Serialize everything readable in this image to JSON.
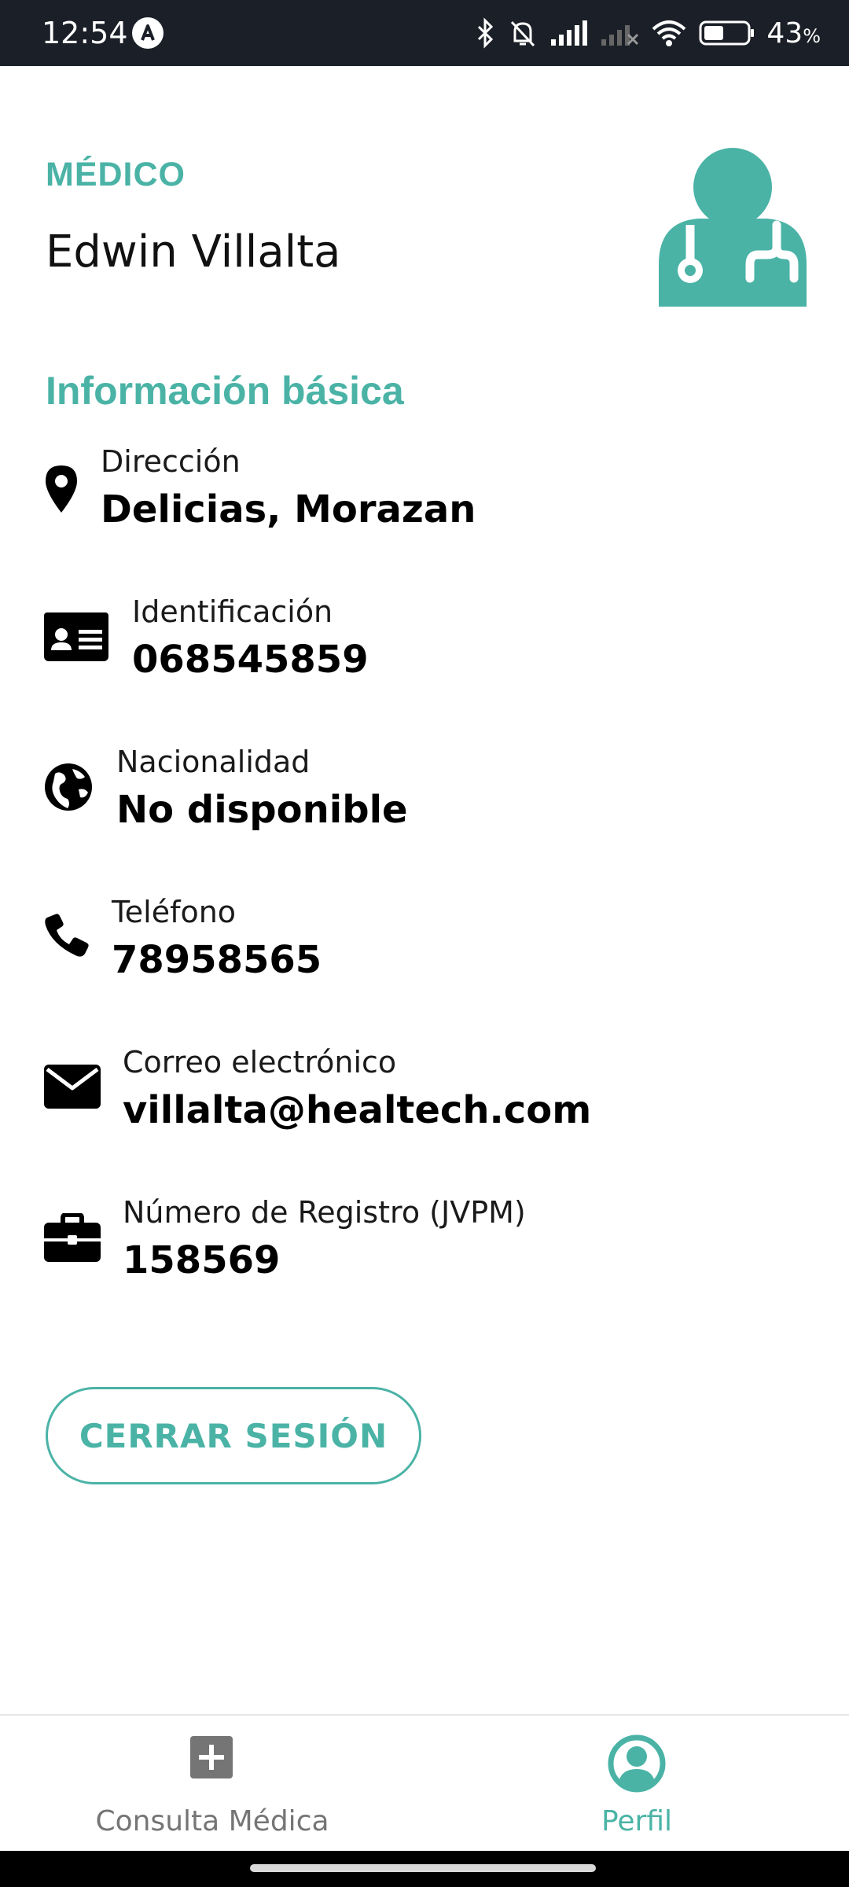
{
  "status_bar": {
    "time": "12:54",
    "battery_percent": "43",
    "battery_unit": "%",
    "icons": [
      "bluetooth-icon",
      "bell-off-icon",
      "signal-icon",
      "signal-no-service-icon",
      "wifi-icon",
      "battery-icon"
    ]
  },
  "profile": {
    "role": "MÉDICO",
    "name": "Edwin Villalta",
    "avatar_icon": "doctor-stethoscope-icon"
  },
  "section_title": "Información básica",
  "info": {
    "address": {
      "label": "Dirección",
      "value": "Delicias, Morazan",
      "icon": "location-pin-icon"
    },
    "identification": {
      "label": "Identificación",
      "value": "068545859",
      "icon": "id-card-icon"
    },
    "nationality": {
      "label": "Nacionalidad",
      "value": "No disponible",
      "icon": "globe-icon"
    },
    "phone": {
      "label": "Teléfono",
      "value": "78958565",
      "icon": "phone-icon"
    },
    "email": {
      "label": "Correo electrónico",
      "value": "villalta@healtech.com",
      "icon": "envelope-icon"
    },
    "registry": {
      "label": "Número de Registro (JVPM)",
      "value": "158569",
      "icon": "briefcase-icon"
    }
  },
  "logout_label": "CERRAR SESIÓN",
  "bottom_nav": {
    "items": [
      {
        "label": "Consulta Médica",
        "icon": "plus-square-icon",
        "active": false
      },
      {
        "label": "Perfil",
        "icon": "user-circle-icon",
        "active": true
      }
    ]
  },
  "colors": {
    "accent": "#4ab3a6",
    "status_bar": "#1b1f27",
    "inactive_nav": "#757575"
  }
}
